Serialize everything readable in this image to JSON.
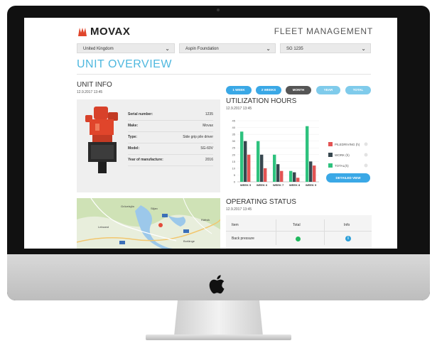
{
  "header": {
    "logo_text": "MOVAX",
    "app_title": "FLEET MANAGEMENT"
  },
  "filters": [
    {
      "value": "United Kingdom"
    },
    {
      "value": "Aspin Foundation"
    },
    {
      "value": "SG 1235"
    }
  ],
  "page_title": "UNIT OVERVIEW",
  "unit_info": {
    "title": "UNIT INFO",
    "date": "12.9.2017 13:45",
    "specs": [
      {
        "label": "Serial number:",
        "value": "1235"
      },
      {
        "label": "Make:",
        "value": "Movax"
      },
      {
        "label": "Type:",
        "value": "Side grip pile driver"
      },
      {
        "label": "Model:",
        "value": "SG-60V"
      },
      {
        "label": "Year of manufacture:",
        "value": "2016"
      }
    ]
  },
  "period_tabs": [
    {
      "label": "1 WEEK",
      "active": false
    },
    {
      "label": "2 WEEKS",
      "active": false
    },
    {
      "label": "MONTH",
      "active": true
    },
    {
      "label": "YEAR",
      "active": false
    },
    {
      "label": "TOTAL",
      "active": false
    }
  ],
  "utilization": {
    "title": "UTILIZATION HOURS",
    "date": "12.9.2017 13:45",
    "detailed_button": "DETAILED VIEW"
  },
  "chart_data": {
    "type": "bar",
    "categories": [
      "WEEK 5",
      "WEEK 6",
      "WEEK 7",
      "WEEK 8",
      "WEEK 9"
    ],
    "series": [
      {
        "name": "TOTAL(h)",
        "color": "#2ec27e",
        "values": [
          37,
          30,
          20,
          8,
          41
        ]
      },
      {
        "name": "WORK (h)",
        "color": "#37474f",
        "values": [
          30,
          20,
          13,
          7,
          15
        ]
      },
      {
        "name": "PILEDRIVING (h)",
        "color": "#e35454",
        "values": [
          20,
          10,
          8,
          3,
          12
        ]
      }
    ],
    "yticks": [
      0,
      5,
      10,
      15,
      20,
      25,
      30,
      35,
      40,
      45
    ],
    "ylim": [
      0,
      45
    ],
    "legend": "right"
  },
  "operating_status": {
    "title": "OPERATING STATUS",
    "date": "12.9.2017 13:45",
    "columns": [
      "Item",
      "Total",
      "Info"
    ],
    "rows": [
      {
        "item": "Back pressure",
        "status_color": "#20b85e",
        "info": "i"
      }
    ]
  },
  "map": {
    "labels": [
      "Grövelsjön",
      "Leksand",
      "Siljan",
      "Rättvik",
      "Borlänge"
    ]
  },
  "colors": {
    "accent": "#4fb8df",
    "pill_blue": "#3aa8e6",
    "pill_light": "#7fcbeb",
    "pill_dark": "#555555"
  }
}
